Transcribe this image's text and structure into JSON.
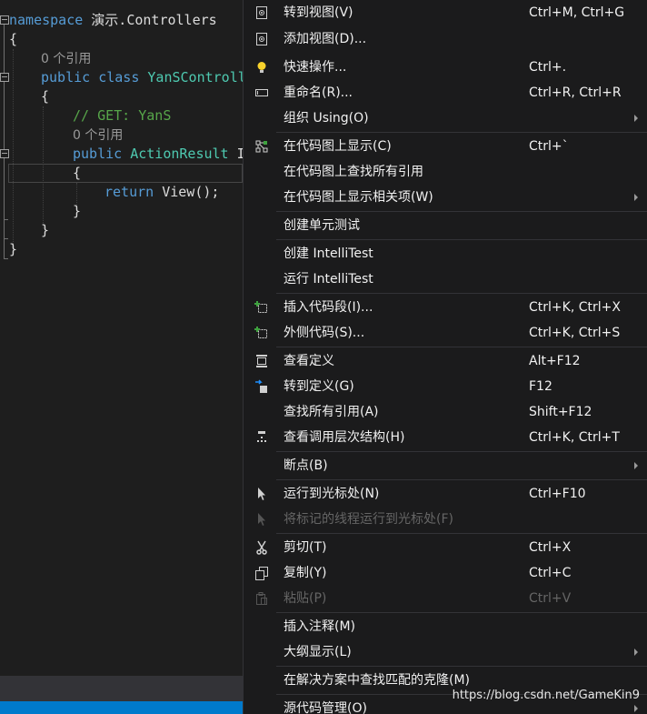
{
  "editor": {
    "line1_kw": "namespace",
    "line1_name": " 演示.Controllers",
    "brace_open": "{",
    "brace_close": "}",
    "refs_a": "0 个引用",
    "line_class_kw": "public class",
    "line_class_name": "YanSControlle",
    "comment": "// GET: YanS",
    "refs_b": "0 个引用",
    "line_method_kw": "public",
    "line_method_type": "ActionResult",
    "line_method_name": "I",
    "return_kw": "return",
    "return_rest": " View();"
  },
  "menu": {
    "items": [
      {
        "label": "转到视图(V)",
        "shortcut": "Ctrl+M, Ctrl+G",
        "icon": "view-icon"
      },
      {
        "label": "添加视图(D)...",
        "shortcut": "",
        "icon": "add-view-icon"
      },
      {
        "label": "快速操作...",
        "shortcut": "Ctrl+.",
        "icon": "lightbulb-icon"
      },
      {
        "label": "重命名(R)...",
        "shortcut": "Ctrl+R, Ctrl+R",
        "icon": "rename-icon"
      },
      {
        "label": "组织 Using(O)",
        "shortcut": "",
        "submenu": true
      },
      {
        "label": "在代码图上显示(C)",
        "shortcut": "Ctrl+`",
        "icon": "code-map-icon"
      },
      {
        "label": "在代码图上查找所有引用",
        "shortcut": ""
      },
      {
        "label": "在代码图上显示相关项(W)",
        "shortcut": "",
        "submenu": true
      },
      {
        "label": "创建单元测试",
        "shortcut": ""
      },
      {
        "label": "创建 IntelliTest",
        "shortcut": ""
      },
      {
        "label": "运行 IntelliTest",
        "shortcut": ""
      },
      {
        "label": "插入代码段(I)...",
        "shortcut": "Ctrl+K, Ctrl+X",
        "icon": "snippet-icon"
      },
      {
        "label": "外侧代码(S)...",
        "shortcut": "Ctrl+K, Ctrl+S",
        "icon": "surround-icon"
      },
      {
        "label": "查看定义",
        "shortcut": "Alt+F12",
        "icon": "peek-definition-icon"
      },
      {
        "label": "转到定义(G)",
        "shortcut": "F12",
        "icon": "goto-definition-icon"
      },
      {
        "label": "查找所有引用(A)",
        "shortcut": "Shift+F12"
      },
      {
        "label": "查看调用层次结构(H)",
        "shortcut": "Ctrl+K, Ctrl+T",
        "icon": "call-hierarchy-icon"
      },
      {
        "label": "断点(B)",
        "shortcut": "",
        "submenu": true
      },
      {
        "label": "运行到光标处(N)",
        "shortcut": "Ctrl+F10",
        "icon": "run-to-cursor-icon"
      },
      {
        "label": "将标记的线程运行到光标处(F)",
        "shortcut": "",
        "disabled": true,
        "icon": "run-flagged-icon"
      },
      {
        "label": "剪切(T)",
        "shortcut": "Ctrl+X",
        "icon": "cut-icon"
      },
      {
        "label": "复制(Y)",
        "shortcut": "Ctrl+C",
        "icon": "copy-icon"
      },
      {
        "label": "粘贴(P)",
        "shortcut": "Ctrl+V",
        "disabled": true,
        "icon": "paste-icon"
      },
      {
        "label": "插入注释(M)",
        "shortcut": ""
      },
      {
        "label": "大纲显示(L)",
        "shortcut": "",
        "submenu": true
      },
      {
        "label": "在解决方案中查找匹配的克隆(M)",
        "shortcut": ""
      },
      {
        "label": "源代码管理(O)",
        "shortcut": "",
        "submenu": true
      }
    ]
  },
  "watermark": "https://blog.csdn.net/GameKin9",
  "colors": {
    "editor_bg": "#1e1e1e",
    "menu_bg": "#1b1b1c",
    "keyword": "#569cd6",
    "type": "#4ec9b0",
    "comment": "#57a64a",
    "status_bar": "#007acc"
  }
}
